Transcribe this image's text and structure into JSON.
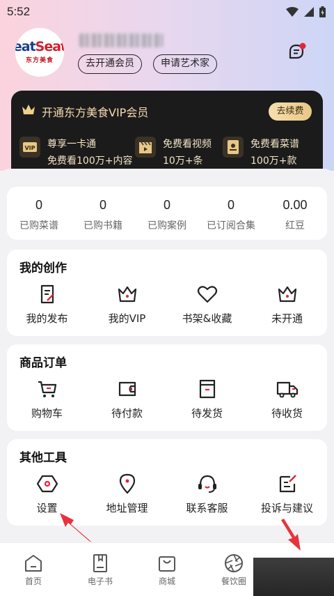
{
  "status": {
    "time": "5:52"
  },
  "avatar": {
    "logo_part1": "eat",
    "logo_part2": "Seat",
    "logo_sub": "东方美食"
  },
  "profile": {
    "join_member": "去开通会员",
    "apply_artist": "申请艺术家"
  },
  "vip": {
    "title": "开通东方美食VIP会员",
    "renew": "去续费",
    "benefits": [
      {
        "icon": "vip-card-icon",
        "line1": "尊享一卡通",
        "line2": "免费看100万+内容"
      },
      {
        "icon": "video-clapper-icon",
        "line1": "免费看视频",
        "line2": "10万+条"
      },
      {
        "icon": "recipe-book-icon",
        "line1": "免费看菜谱",
        "line2": "100万+款"
      }
    ]
  },
  "stats": [
    {
      "value": "0",
      "label": "已购菜谱"
    },
    {
      "value": "0",
      "label": "已购书籍"
    },
    {
      "value": "0",
      "label": "已购案例"
    },
    {
      "value": "0",
      "label": "已订阅合集"
    },
    {
      "value": "0.00",
      "label": "红豆"
    }
  ],
  "creation": {
    "title": "我的创作",
    "items": [
      {
        "icon": "publish-icon",
        "label": "我的发布"
      },
      {
        "icon": "crown-icon",
        "label": "我的VIP"
      },
      {
        "icon": "heart-icon",
        "label": "书架&收藏"
      },
      {
        "icon": "crown-icon",
        "label": "未开通"
      }
    ]
  },
  "orders": {
    "title": "商品订单",
    "items": [
      {
        "icon": "cart-icon",
        "label": "购物车"
      },
      {
        "icon": "wallet-icon",
        "label": "待付款"
      },
      {
        "icon": "box-icon",
        "label": "待发货"
      },
      {
        "icon": "truck-icon",
        "label": "待收货"
      }
    ]
  },
  "tools": {
    "title": "其他工具",
    "items": [
      {
        "icon": "settings-icon",
        "label": "设置"
      },
      {
        "icon": "location-pin-icon",
        "label": "地址管理"
      },
      {
        "icon": "headset-icon",
        "label": "联系客服"
      },
      {
        "icon": "feedback-icon",
        "label": "投诉与建议"
      }
    ]
  },
  "tabs": [
    {
      "icon": "home-icon",
      "label": "首页"
    },
    {
      "icon": "ebook-icon",
      "label": "电子书"
    },
    {
      "icon": "shop-bag-icon",
      "label": "商城"
    },
    {
      "icon": "aperture-icon",
      "label": "餐饮圈"
    },
    {
      "icon": "profile-icon",
      "label": ""
    }
  ],
  "colors": {
    "accent": "#e5243b",
    "vip_gold": "#f5dcae",
    "vip_bg": "#1b1b1b",
    "annotation_arrow": "#e8323c"
  }
}
